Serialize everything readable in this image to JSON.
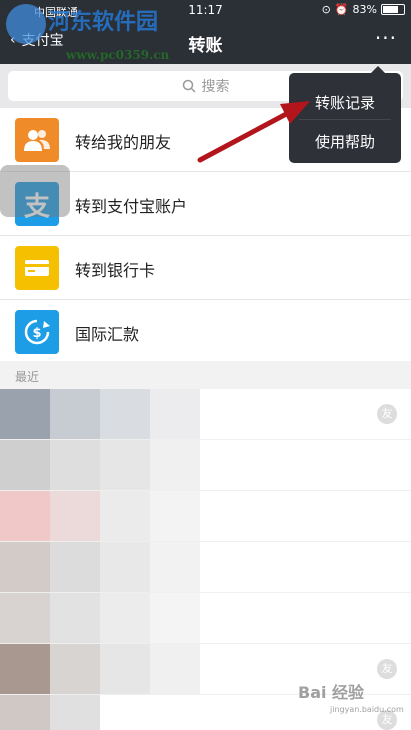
{
  "status_bar": {
    "carrier": "中国联通",
    "time": "11:17",
    "battery_text": "83%",
    "battery_level": 0.83
  },
  "nav": {
    "back_label": "支付宝",
    "title": "转账",
    "more_label": "···"
  },
  "search": {
    "placeholder": "搜索"
  },
  "transfer_options": [
    {
      "label": "转给我的朋友",
      "icon": "friends-icon",
      "color": "#f08b2a"
    },
    {
      "label": "转到支付宝账户",
      "icon": "alipay-icon",
      "color": "#1c9de6"
    },
    {
      "label": "转到银行卡",
      "icon": "bank-card-icon",
      "color": "#f5c000"
    },
    {
      "label": "国际汇款",
      "icon": "international-remit-icon",
      "color": "#1c9de6"
    }
  ],
  "recent": {
    "header": "最近",
    "friend_badge": "友"
  },
  "popup_menu": {
    "items": [
      "转账记录",
      "使用帮助"
    ]
  },
  "watermark": {
    "title": "河东软件园",
    "url": "www.pc0359.cn",
    "baidu": "Bai 经验",
    "baidu_url": "jingyan.baidu.com"
  },
  "colors": {
    "nav_bg": "#2b2f36",
    "arrow": "#b3151c"
  }
}
